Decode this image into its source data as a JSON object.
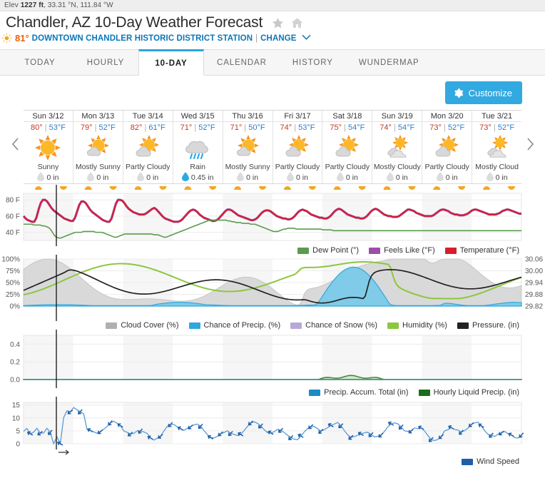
{
  "header": {
    "elevation_prefix": "Elev ",
    "elevation_value": "1227 ft",
    "coords": ", 33.31 °N, 111.84 °W",
    "title": "Chandler, AZ 10-Day Weather Forecast",
    "current_temp": "81°",
    "station_name": "DOWNTOWN CHANDLER HISTORIC DISTRICT STATION",
    "separator": "|",
    "change_label": "CHANGE",
    "star_icon": "star-icon",
    "home_icon": "home-icon",
    "sun_icon": "sun-icon",
    "chevron_icon": "chevron-down-icon"
  },
  "tabs": [
    {
      "label": "TODAY",
      "active": false
    },
    {
      "label": "HOURLY",
      "active": false
    },
    {
      "label": "10-DAY",
      "active": true
    },
    {
      "label": "CALENDAR",
      "active": false
    },
    {
      "label": "HISTORY",
      "active": false
    },
    {
      "label": "WUNDERMAP",
      "active": false
    }
  ],
  "toolbar": {
    "customize_label": "Customize",
    "gear_icon": "gear-icon",
    "customize_color": "#32a9e0"
  },
  "forecast": {
    "prev_label": "‹",
    "next_label": "›",
    "days": [
      {
        "name": "Sun 3/12",
        "hi": "80°",
        "sep": "|",
        "lo": "53°F",
        "icon": "sunny-icon",
        "condition": "Sunny",
        "precip": "0 in",
        "precip_wet": false
      },
      {
        "name": "Mon 3/13",
        "hi": "79°",
        "sep": "|",
        "lo": "52°F",
        "icon": "mostly-sunny-icon",
        "condition": "Mostly Sunny",
        "precip": "0 in",
        "precip_wet": false
      },
      {
        "name": "Tue 3/14",
        "hi": "82°",
        "sep": "|",
        "lo": "61°F",
        "icon": "partly-cloudy-icon",
        "condition": "Partly Cloudy",
        "precip": "0 in",
        "precip_wet": false
      },
      {
        "name": "Wed 3/15",
        "hi": "71°",
        "sep": "|",
        "lo": "52°F",
        "icon": "rain-icon",
        "condition": "Rain",
        "precip": "0.45 in",
        "precip_wet": true
      },
      {
        "name": "Thu 3/16",
        "hi": "71°",
        "sep": "|",
        "lo": "50°F",
        "icon": "mostly-sunny-icon",
        "condition": "Mostly Sunny",
        "precip": "0 in",
        "precip_wet": false
      },
      {
        "name": "Fri 3/17",
        "hi": "74°",
        "sep": "|",
        "lo": "53°F",
        "icon": "partly-cloudy-icon",
        "condition": "Partly Cloudy",
        "precip": "0 in",
        "precip_wet": false
      },
      {
        "name": "Sat 3/18",
        "hi": "75°",
        "sep": "|",
        "lo": "54°F",
        "icon": "partly-cloudy-icon",
        "condition": "Partly Cloudy",
        "precip": "0 in",
        "precip_wet": false
      },
      {
        "name": "Sun 3/19",
        "hi": "74°",
        "sep": "|",
        "lo": "54°F",
        "icon": "mostly-cloudy-icon",
        "condition": "Mostly Cloudy",
        "precip": "0 in",
        "precip_wet": false
      },
      {
        "name": "Mon 3/20",
        "hi": "73°",
        "sep": "|",
        "lo": "52°F",
        "icon": "partly-cloudy-icon",
        "condition": "Partly Cloudy",
        "precip": "0 in",
        "precip_wet": false
      },
      {
        "name": "Tue 3/21",
        "hi": "73°",
        "sep": "|",
        "lo": "52°F",
        "icon": "mostly-cloudy-icon",
        "condition": "Mostly Cloud",
        "precip": "0 in",
        "precip_wet": false
      }
    ]
  },
  "chart_data": [
    {
      "id": "temperature",
      "type": "line",
      "title": "",
      "xlabel": "",
      "ylabel": "",
      "ylim": [
        30,
        88
      ],
      "yticks": [
        40,
        60,
        80
      ],
      "ytick_labels": [
        "40 F",
        "60 F",
        "80 F"
      ],
      "grid": true,
      "legend_position": "bottom-right",
      "series": [
        {
          "name": "Temperature (°F)",
          "color": "#d91e2a",
          "values": [
            60,
            57,
            55,
            54,
            53,
            53,
            58,
            68,
            76,
            80,
            80,
            78,
            74,
            70,
            67,
            65,
            63,
            61,
            59,
            57,
            56,
            55,
            54,
            54,
            58,
            66,
            74,
            78,
            78,
            76,
            72,
            68,
            65,
            63,
            61,
            59,
            57,
            55,
            54,
            53,
            53,
            57,
            66,
            75,
            80,
            80,
            79,
            76,
            72,
            69,
            67,
            65,
            64,
            63,
            62,
            62,
            62,
            63,
            65,
            67,
            69,
            70,
            68,
            65,
            62,
            59,
            57,
            56,
            55,
            54,
            53,
            53,
            53,
            54,
            56,
            59,
            62,
            65,
            67,
            68,
            67,
            65,
            62,
            60,
            58,
            57,
            56,
            55,
            54,
            54,
            55,
            57,
            60,
            63,
            66,
            68,
            68,
            67,
            65,
            63,
            61,
            60,
            59,
            58,
            57,
            56,
            55,
            55,
            56,
            58,
            61,
            64,
            66,
            67,
            67,
            66,
            64,
            62,
            60,
            59,
            58,
            57,
            57,
            56,
            56,
            57,
            59,
            62,
            65,
            67,
            68,
            67,
            66,
            64,
            62,
            61,
            60,
            59,
            58,
            58,
            57,
            57,
            58,
            60,
            63,
            66,
            68,
            69,
            68,
            66,
            64,
            62,
            61,
            60,
            59,
            58,
            58,
            57,
            57,
            58,
            60,
            63,
            66,
            68,
            69,
            68,
            66,
            64,
            62,
            61,
            60,
            60,
            59,
            59,
            59,
            60,
            62,
            64,
            66,
            68,
            68,
            67,
            66,
            64,
            63,
            62,
            61,
            60,
            60,
            60,
            60,
            61,
            63,
            65,
            67,
            68,
            68,
            67,
            66,
            64,
            63,
            62,
            62,
            61,
            61,
            61,
            62,
            63,
            65,
            67,
            68,
            68,
            67,
            66,
            65,
            64,
            63,
            62,
            62,
            62,
            62,
            63,
            64,
            66,
            67,
            68,
            68,
            67,
            66,
            65,
            64,
            63,
            63
          ]
        },
        {
          "name": "Feels Like (°F)",
          "color": "#9b4fa8",
          "values": []
        },
        {
          "name": "Dew Point (°)",
          "color": "#5b9b4e",
          "values": [
            50,
            50,
            50,
            50,
            50,
            49,
            49,
            49,
            49,
            48,
            48,
            47,
            46,
            44,
            40,
            36,
            34,
            33,
            33,
            34,
            35,
            36,
            37,
            38,
            39,
            40,
            40,
            40,
            40,
            41,
            41,
            41,
            41,
            41,
            41,
            40,
            40,
            40,
            40,
            39,
            38,
            37,
            36,
            35,
            34,
            34,
            35,
            36,
            37,
            38,
            38,
            38,
            38,
            38,
            38,
            38,
            38,
            38,
            38,
            38,
            38,
            38,
            38,
            37,
            37,
            37,
            36,
            35,
            34,
            34,
            35,
            36,
            37,
            38,
            39,
            40,
            41,
            42,
            43,
            44,
            45,
            46,
            47,
            48,
            49,
            50,
            51,
            52,
            53,
            54,
            55,
            55,
            55,
            55,
            55,
            55,
            55,
            55,
            55,
            54,
            54,
            53,
            53,
            52,
            52,
            52,
            51,
            51,
            51,
            51,
            50,
            50,
            50,
            49,
            48,
            47,
            46,
            45,
            44,
            43,
            42,
            41,
            41,
            41,
            42,
            43,
            44,
            44,
            45,
            45,
            45,
            45,
            44,
            44,
            44,
            44,
            44,
            44,
            44,
            44,
            44,
            44,
            44,
            44,
            44,
            43,
            43,
            43,
            43,
            43,
            42,
            42,
            42,
            42,
            42,
            42,
            42,
            42,
            42,
            42,
            42,
            42,
            42,
            42,
            42,
            42,
            42,
            42,
            42,
            42,
            42,
            42,
            42,
            42,
            42,
            42,
            42,
            42,
            42,
            42,
            42,
            42,
            42,
            42,
            42,
            42,
            42,
            42,
            42,
            42,
            42,
            42,
            42,
            42,
            42,
            42,
            42,
            42,
            42,
            42,
            42,
            42,
            42,
            42,
            42,
            42,
            42,
            42,
            42,
            42,
            42,
            42,
            42,
            42,
            42,
            42,
            42,
            42,
            42,
            42,
            42,
            42,
            42,
            42,
            42,
            42,
            42,
            42,
            42,
            42,
            42,
            42,
            42,
            42,
            42,
            42,
            42,
            42,
            42,
            42,
            42,
            42
          ]
        }
      ]
    },
    {
      "id": "cloud-humidity-pressure",
      "type": "area-line",
      "ylim_left": [
        0,
        100
      ],
      "yticks_left": [
        0,
        25,
        50,
        75,
        100
      ],
      "ytick_labels_left": [
        "0%",
        "25%",
        "50%",
        "75%",
        "100%"
      ],
      "ylim_right": [
        29.82,
        30.06
      ],
      "yticks_right": [
        29.82,
        29.88,
        29.94,
        30.0,
        30.06
      ],
      "ytick_labels_right": [
        "29.82",
        "29.88",
        "29.94",
        "30.00",
        "30.06"
      ],
      "grid": true,
      "legend_position": "bottom-right",
      "series": [
        {
          "name": "Cloud Cover (%)",
          "color": "#b0b0b0",
          "kind": "area"
        },
        {
          "name": "Chance of Precip. (%)",
          "color": "#2fa8dd",
          "kind": "area"
        },
        {
          "name": "Chance of Snow (%)",
          "color": "#b8a8d8",
          "kind": "area"
        },
        {
          "name": "Humidity (%)",
          "color": "#8dc63f",
          "kind": "line"
        },
        {
          "name": "Pressure. (in)",
          "color": "#222222",
          "kind": "line"
        }
      ]
    },
    {
      "id": "precipitation",
      "type": "area",
      "ylim": [
        0,
        0.5
      ],
      "yticks": [
        0.0,
        0.2,
        0.4
      ],
      "ytick_labels": [
        "0.0",
        "0.2",
        "0.4"
      ],
      "grid": true,
      "legend_position": "bottom-right",
      "series": [
        {
          "name": "Precip. Accum. Total (in)",
          "color": "#1b8dc4",
          "kind": "area"
        },
        {
          "name": "Hourly Liquid Precip. (in)",
          "color": "#1d6b1d",
          "kind": "area"
        }
      ]
    },
    {
      "id": "wind",
      "type": "line",
      "ylim": [
        0,
        16
      ],
      "yticks": [
        0,
        5,
        10,
        15
      ],
      "ytick_labels": [
        "0",
        "5",
        "10",
        "15"
      ],
      "grid": true,
      "legend_position": "bottom-right",
      "series": [
        {
          "name": "Wind Speed",
          "color": "#1f5fa8",
          "kind": "line-arrows"
        }
      ]
    }
  ]
}
